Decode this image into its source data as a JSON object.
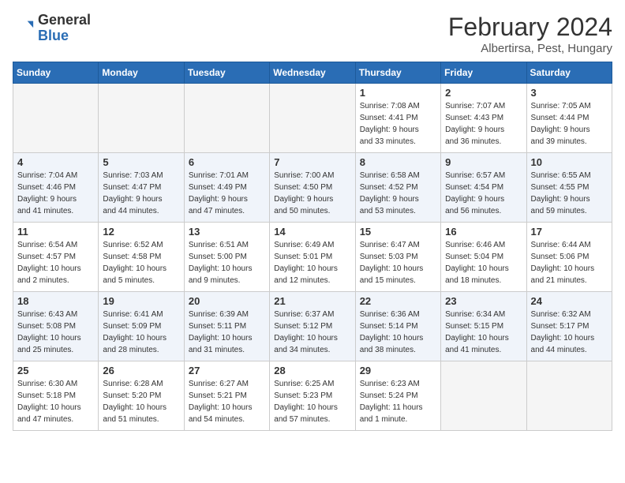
{
  "header": {
    "logo_general": "General",
    "logo_blue": "Blue",
    "month": "February 2024",
    "location": "Albertirsa, Pest, Hungary"
  },
  "days_of_week": [
    "Sunday",
    "Monday",
    "Tuesday",
    "Wednesday",
    "Thursday",
    "Friday",
    "Saturday"
  ],
  "weeks": [
    [
      {
        "day": "",
        "info": ""
      },
      {
        "day": "",
        "info": ""
      },
      {
        "day": "",
        "info": ""
      },
      {
        "day": "",
        "info": ""
      },
      {
        "day": "1",
        "info": "Sunrise: 7:08 AM\nSunset: 4:41 PM\nDaylight: 9 hours\nand 33 minutes."
      },
      {
        "day": "2",
        "info": "Sunrise: 7:07 AM\nSunset: 4:43 PM\nDaylight: 9 hours\nand 36 minutes."
      },
      {
        "day": "3",
        "info": "Sunrise: 7:05 AM\nSunset: 4:44 PM\nDaylight: 9 hours\nand 39 minutes."
      }
    ],
    [
      {
        "day": "4",
        "info": "Sunrise: 7:04 AM\nSunset: 4:46 PM\nDaylight: 9 hours\nand 41 minutes."
      },
      {
        "day": "5",
        "info": "Sunrise: 7:03 AM\nSunset: 4:47 PM\nDaylight: 9 hours\nand 44 minutes."
      },
      {
        "day": "6",
        "info": "Sunrise: 7:01 AM\nSunset: 4:49 PM\nDaylight: 9 hours\nand 47 minutes."
      },
      {
        "day": "7",
        "info": "Sunrise: 7:00 AM\nSunset: 4:50 PM\nDaylight: 9 hours\nand 50 minutes."
      },
      {
        "day": "8",
        "info": "Sunrise: 6:58 AM\nSunset: 4:52 PM\nDaylight: 9 hours\nand 53 minutes."
      },
      {
        "day": "9",
        "info": "Sunrise: 6:57 AM\nSunset: 4:54 PM\nDaylight: 9 hours\nand 56 minutes."
      },
      {
        "day": "10",
        "info": "Sunrise: 6:55 AM\nSunset: 4:55 PM\nDaylight: 9 hours\nand 59 minutes."
      }
    ],
    [
      {
        "day": "11",
        "info": "Sunrise: 6:54 AM\nSunset: 4:57 PM\nDaylight: 10 hours\nand 2 minutes."
      },
      {
        "day": "12",
        "info": "Sunrise: 6:52 AM\nSunset: 4:58 PM\nDaylight: 10 hours\nand 5 minutes."
      },
      {
        "day": "13",
        "info": "Sunrise: 6:51 AM\nSunset: 5:00 PM\nDaylight: 10 hours\nand 9 minutes."
      },
      {
        "day": "14",
        "info": "Sunrise: 6:49 AM\nSunset: 5:01 PM\nDaylight: 10 hours\nand 12 minutes."
      },
      {
        "day": "15",
        "info": "Sunrise: 6:47 AM\nSunset: 5:03 PM\nDaylight: 10 hours\nand 15 minutes."
      },
      {
        "day": "16",
        "info": "Sunrise: 6:46 AM\nSunset: 5:04 PM\nDaylight: 10 hours\nand 18 minutes."
      },
      {
        "day": "17",
        "info": "Sunrise: 6:44 AM\nSunset: 5:06 PM\nDaylight: 10 hours\nand 21 minutes."
      }
    ],
    [
      {
        "day": "18",
        "info": "Sunrise: 6:43 AM\nSunset: 5:08 PM\nDaylight: 10 hours\nand 25 minutes."
      },
      {
        "day": "19",
        "info": "Sunrise: 6:41 AM\nSunset: 5:09 PM\nDaylight: 10 hours\nand 28 minutes."
      },
      {
        "day": "20",
        "info": "Sunrise: 6:39 AM\nSunset: 5:11 PM\nDaylight: 10 hours\nand 31 minutes."
      },
      {
        "day": "21",
        "info": "Sunrise: 6:37 AM\nSunset: 5:12 PM\nDaylight: 10 hours\nand 34 minutes."
      },
      {
        "day": "22",
        "info": "Sunrise: 6:36 AM\nSunset: 5:14 PM\nDaylight: 10 hours\nand 38 minutes."
      },
      {
        "day": "23",
        "info": "Sunrise: 6:34 AM\nSunset: 5:15 PM\nDaylight: 10 hours\nand 41 minutes."
      },
      {
        "day": "24",
        "info": "Sunrise: 6:32 AM\nSunset: 5:17 PM\nDaylight: 10 hours\nand 44 minutes."
      }
    ],
    [
      {
        "day": "25",
        "info": "Sunrise: 6:30 AM\nSunset: 5:18 PM\nDaylight: 10 hours\nand 47 minutes."
      },
      {
        "day": "26",
        "info": "Sunrise: 6:28 AM\nSunset: 5:20 PM\nDaylight: 10 hours\nand 51 minutes."
      },
      {
        "day": "27",
        "info": "Sunrise: 6:27 AM\nSunset: 5:21 PM\nDaylight: 10 hours\nand 54 minutes."
      },
      {
        "day": "28",
        "info": "Sunrise: 6:25 AM\nSunset: 5:23 PM\nDaylight: 10 hours\nand 57 minutes."
      },
      {
        "day": "29",
        "info": "Sunrise: 6:23 AM\nSunset: 5:24 PM\nDaylight: 11 hours\nand 1 minute."
      },
      {
        "day": "",
        "info": ""
      },
      {
        "day": "",
        "info": ""
      }
    ]
  ]
}
